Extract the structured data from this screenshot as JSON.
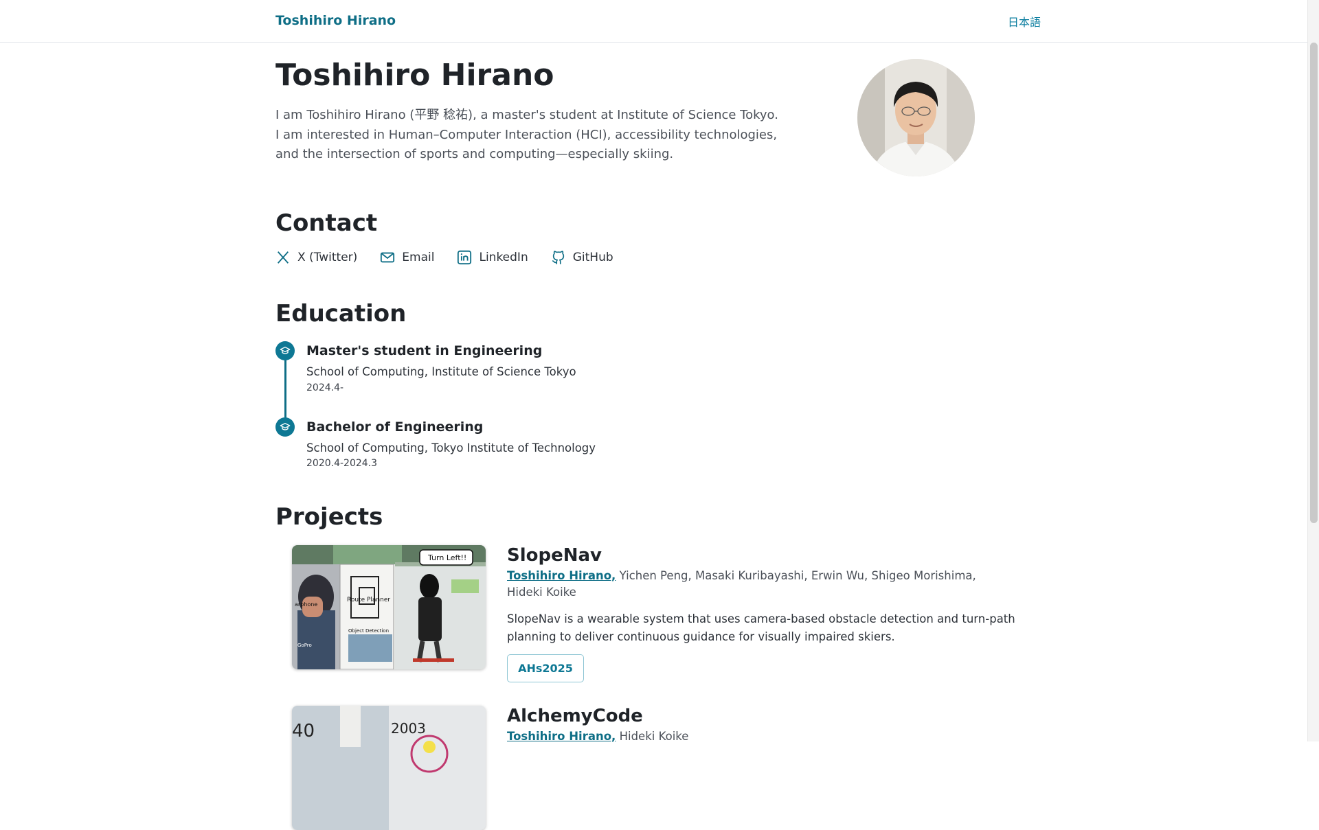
{
  "header": {
    "brand": "Toshihiro Hirano",
    "lang_toggle": "日本語"
  },
  "profile": {
    "name": "Toshihiro Hirano",
    "bio": [
      "I am Toshihiro Hirano (平野 稔祐), a master's student at Institute of Science Tokyo.",
      "I am interested in Human–Computer Interaction (HCI), accessibility technologies, and the intersection of sports and computing—especially skiing."
    ]
  },
  "contact": {
    "title": "Contact",
    "links": [
      {
        "label": "X (Twitter)",
        "icon": "x-icon"
      },
      {
        "label": "Email",
        "icon": "mail-icon"
      },
      {
        "label": "LinkedIn",
        "icon": "linkedin-icon"
      },
      {
        "label": "GitHub",
        "icon": "github-icon"
      }
    ]
  },
  "education": {
    "title": "Education",
    "items": [
      {
        "degree": "Master's student in Engineering",
        "school": "School of Computing, Institute of Science Tokyo",
        "date": "2024.4-"
      },
      {
        "degree": "Bachelor of Engineering",
        "school": "School of Computing, Tokyo Institute of Technology",
        "date": "2020.4-2024.3"
      }
    ]
  },
  "projects": {
    "title": "Projects",
    "items": [
      {
        "title": "SlopeNav",
        "author_self": "Toshihiro Hirano,",
        "authors_rest": "Yichen Peng, Masaki Kuribayashi, Erwin Wu, Shigeo Morishima, Hideki Koike",
        "description": "SlopeNav is a wearable system that uses camera-based obstacle detection and turn-path planning to deliver continuous guidance for visually impaired skiers.",
        "badge": "AHs2025",
        "image_text": {
          "bubble": "Turn Left!!",
          "planner": "Route Planner",
          "detection": "Object Detection",
          "gopro": "GoPro",
          "earphone": "arphone"
        }
      },
      {
        "title": "AlchemyCode",
        "author_self": "Toshihiro Hirano,",
        "authors_rest": "Hideki Koike",
        "image_text": {
          "left_num": "40",
          "right_num": "2003"
        }
      }
    ]
  },
  "colors": {
    "accent": "#0e6e86",
    "badge_border": "#8ec6d4"
  }
}
